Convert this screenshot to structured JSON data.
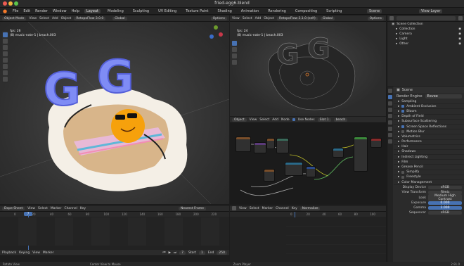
{
  "window": {
    "title": "fried-egg6.blend"
  },
  "menubar": {
    "menus": [
      "File",
      "Edit",
      "Render",
      "Window",
      "Help"
    ],
    "tabs": [
      "Layout",
      "Modeling",
      "Sculpting",
      "UV Editing",
      "Texture Paint",
      "Shading",
      "Animation",
      "Rendering",
      "Compositing",
      "Scripting"
    ],
    "scene_label": "Scene",
    "view_layer_label": "View Layer"
  },
  "vp1": {
    "mode": "Object Mode",
    "menus": [
      "View",
      "Select",
      "Add",
      "Object"
    ],
    "addon": "RetopoFlow 3.0.0",
    "orientation": "Global",
    "options": "Options",
    "fps": "fps: 26",
    "object_info": "(8) music-note-1 | beach.003"
  },
  "vp2": {
    "menus": [
      "View",
      "Select",
      "Add",
      "Object"
    ],
    "addon": "RetopoFlow 3.1.0 (self)",
    "orientation": "Global",
    "options": "Options",
    "fps": "fps: 24",
    "object_info": "(8) music-note-1 | beach.003"
  },
  "node": {
    "editor": "Object",
    "menus": [
      "View",
      "Select",
      "Add",
      "Node"
    ],
    "use_nodes": "Use Nodes",
    "slot": "Slot 1",
    "material": "beach"
  },
  "outliner": {
    "title": "Scene Collection",
    "items": [
      "Collection",
      "Camera",
      "Light",
      "Other"
    ]
  },
  "props": {
    "scene": "Scene",
    "render_engine_label": "Render Engine",
    "render_engine_value": "Eevee",
    "sections": [
      {
        "label": "Sampling",
        "checkbox": false
      },
      {
        "label": "Ambient Occlusion",
        "checkbox": true,
        "on": true
      },
      {
        "label": "Bloom",
        "checkbox": true,
        "on": true
      },
      {
        "label": "Depth of Field",
        "checkbox": false
      },
      {
        "label": "Subsurface Scattering",
        "checkbox": false
      },
      {
        "label": "Screen Space Reflections",
        "checkbox": true,
        "on": true
      },
      {
        "label": "Motion Blur",
        "checkbox": true,
        "on": false
      },
      {
        "label": "Volumetrics",
        "checkbox": false
      },
      {
        "label": "Performance",
        "checkbox": false
      },
      {
        "label": "Hair",
        "checkbox": false
      },
      {
        "label": "Shadows",
        "checkbox": false
      },
      {
        "label": "Indirect Lighting",
        "checkbox": false
      },
      {
        "label": "Film",
        "checkbox": false
      },
      {
        "label": "Grease Pencil",
        "checkbox": false
      },
      {
        "label": "Simplify",
        "checkbox": true,
        "on": false
      },
      {
        "label": "Freestyle",
        "checkbox": true,
        "on": false
      },
      {
        "label": "Color Management",
        "checkbox": false
      }
    ],
    "cm": [
      {
        "label": "Display Device",
        "value": "sRGB"
      },
      {
        "label": "View Transform",
        "value": "Filmic"
      },
      {
        "label": "Look",
        "value": "Medium High Contrast"
      },
      {
        "label": "Exposure",
        "value": "0.000",
        "bar": true
      },
      {
        "label": "Gamma",
        "value": "1.000",
        "bar": true
      },
      {
        "label": "Sequencer",
        "value": "sRGB"
      }
    ]
  },
  "tl1": {
    "mode": "Dope Sheet",
    "menus": [
      "View",
      "Select",
      "Marker",
      "Channel",
      "Key"
    ],
    "filter": "Nearest Frame",
    "ticks": [
      "0",
      "20",
      "40",
      "60",
      "80",
      "100",
      "120",
      "140",
      "160",
      "180",
      "200",
      "220"
    ],
    "play_menus": [
      "Playback",
      "Keying",
      "View",
      "Marker"
    ],
    "start_label": "Start",
    "start": "1",
    "end_label": "End",
    "end": "250",
    "current": "7"
  },
  "tl2": {
    "menus": [
      "View",
      "Select",
      "Marker",
      "Channel",
      "Key"
    ],
    "filter": "Normalize",
    "ticks": [
      "0",
      "20",
      "40",
      "60",
      "80",
      "100"
    ]
  },
  "status": {
    "left": "Rotate View",
    "mid": "Center View to Mouse",
    "right": "Zoom Player",
    "version": "2.91.0"
  },
  "colors": {
    "accent": "#4772b3",
    "balloon": "#7f8cf5",
    "egg_white": "#f4efe6",
    "yolk": "#f6a10c",
    "towel": "#e8b9d6"
  }
}
